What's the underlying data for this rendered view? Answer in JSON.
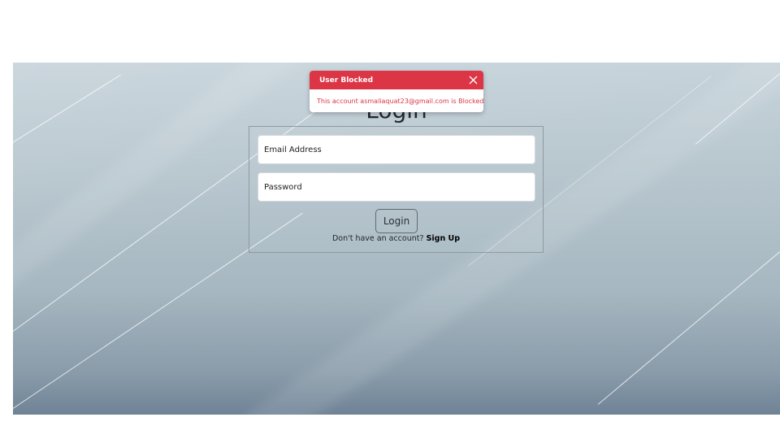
{
  "login": {
    "title": "Login",
    "email_placeholder": "Email Address",
    "password_placeholder": "Password",
    "login_button": "Login",
    "signup_prompt": "Don't have an account?",
    "signup_link": "Sign Up"
  },
  "toast": {
    "title": "User Blocked",
    "message": "This account asmaliaquat23@gmail.com is Blocked!",
    "close_icon": "close-icon"
  },
  "colors": {
    "toast_accent": "#dc3545",
    "background_top": "#c6d3da",
    "background_bottom": "#6f8396"
  }
}
